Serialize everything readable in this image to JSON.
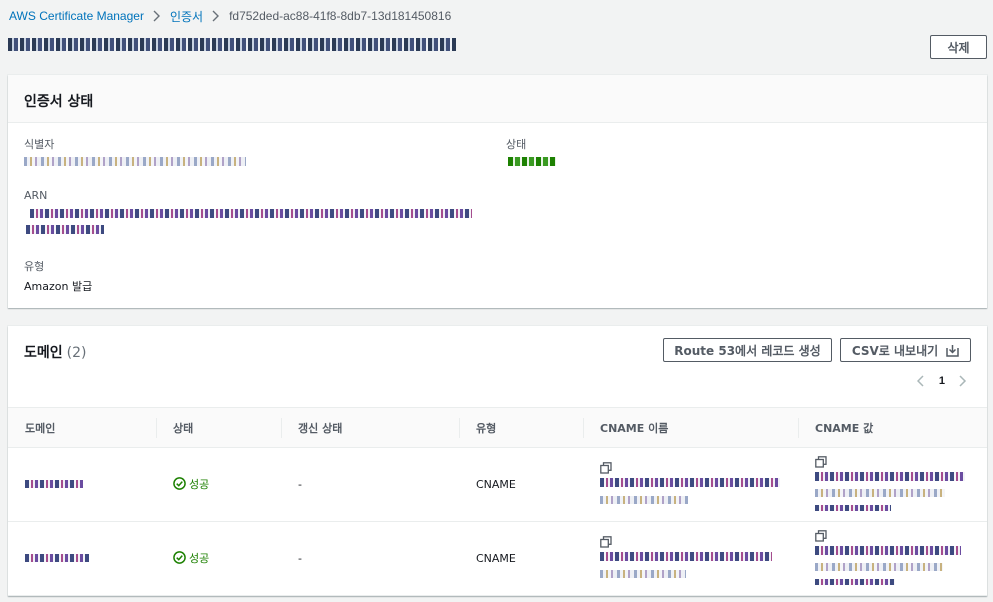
{
  "breadcrumb": {
    "items": [
      "AWS Certificate Manager",
      "인증서"
    ],
    "current": "fd752ded-ac88-41f8-8db7-13d181450816"
  },
  "header": {
    "delete_label": "삭제"
  },
  "status_panel": {
    "title": "인증서 상태",
    "identifier_label": "식별자",
    "arn_label": "ARN",
    "type_label": "유형",
    "type_value": "Amazon 발급",
    "status_label": "상태"
  },
  "domains_panel": {
    "title": "도메인",
    "count": "(2)",
    "route53_label": "Route 53에서 레코드 생성",
    "csv_label": "CSV로 내보내기",
    "page": "1",
    "columns": [
      "도메인",
      "상태",
      "갱신 상태",
      "유형",
      "CNAME 이름",
      "CNAME 값"
    ],
    "rows": [
      {
        "status": "성공",
        "renewal": "-",
        "type": "CNAME"
      },
      {
        "status": "성공",
        "renewal": "-",
        "type": "CNAME"
      }
    ]
  }
}
